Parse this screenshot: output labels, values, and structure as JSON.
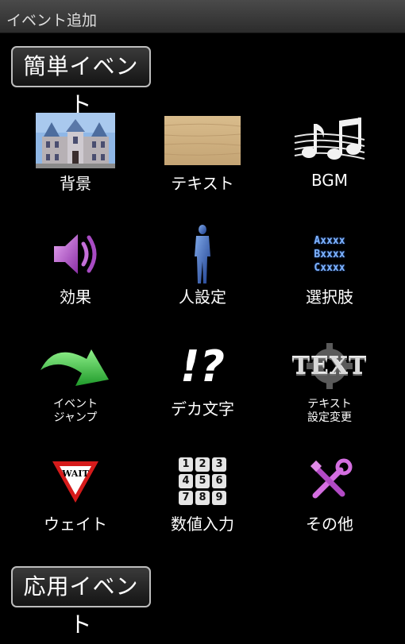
{
  "window": {
    "title": "イベント追加"
  },
  "sections": {
    "simple": "簡単イベント",
    "applied": "応用イベント"
  },
  "items": [
    {
      "label": "背景",
      "icon": "castle-background-icon"
    },
    {
      "label": "テキスト",
      "icon": "wood-text-panel-icon"
    },
    {
      "label": "BGM",
      "icon": "music-notes-icon"
    },
    {
      "label": "効果",
      "icon": "speaker-icon"
    },
    {
      "label": "人設定",
      "icon": "person-silhouette-icon"
    },
    {
      "label": "選択肢",
      "icon": "choices-abc-icon",
      "choices": [
        "Axxxx",
        "Bxxxx",
        "Cxxxx"
      ]
    },
    {
      "label": "イベント\nジャンプ",
      "icon": "green-arrow-icon"
    },
    {
      "label": "デカ文字",
      "icon": "exclamation-question-icon",
      "glyph": "!?"
    },
    {
      "label": "テキスト\n設定変更",
      "icon": "text-gear-icon",
      "glyph": "TEXT"
    },
    {
      "label": "ウェイト",
      "icon": "wait-sign-icon",
      "glyph": "WAIT"
    },
    {
      "label": "数値入力",
      "icon": "number-keypad-icon",
      "keys": [
        "1",
        "2",
        "3",
        "4",
        "5",
        "6",
        "7",
        "8",
        "9"
      ]
    },
    {
      "label": "その他",
      "icon": "tools-icon"
    }
  ]
}
